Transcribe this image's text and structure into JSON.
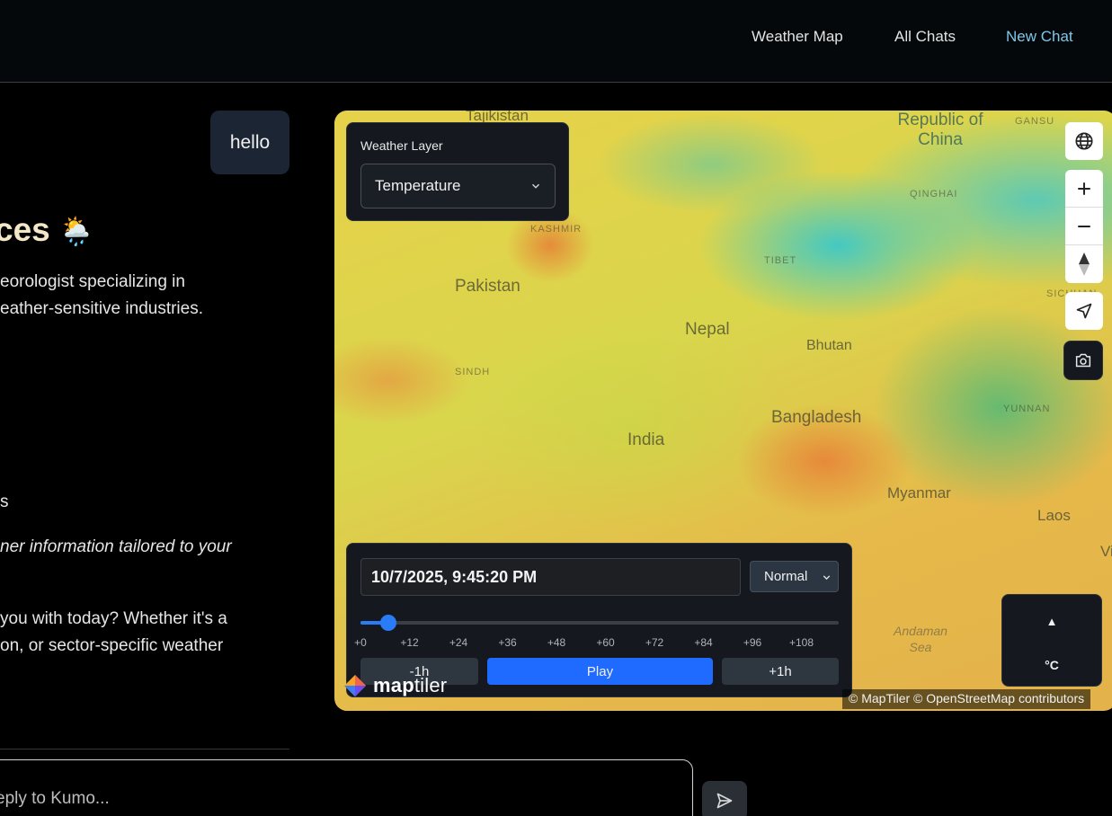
{
  "nav": {
    "items": [
      {
        "label": "Weather Map"
      },
      {
        "label": "All Chats"
      },
      {
        "label": "New Chat"
      }
    ]
  },
  "chat": {
    "user_message": "hello",
    "assistant": {
      "title": "ces",
      "title_emoji": "🌦️",
      "intro_line1": "eorologist specializing in",
      "intro_line2": "eather-sensitive industries.",
      "list_fragment": "s",
      "tagline": "ner information tailored to your",
      "question_line1": " you with today? Whether it's a",
      "question_line2": "on, or sector-specific weather"
    },
    "composer": {
      "placeholder": "eply to Kumo..."
    }
  },
  "map": {
    "weather_layer": {
      "title": "Weather Layer",
      "selected": "Temperature"
    },
    "labels": {
      "tajikistan": "Tajikistan",
      "china": "Republic of China",
      "pakistan": "Pakistan",
      "nepal": "Nepal",
      "bhutan": "Bhutan",
      "bangladesh": "Bangladesh",
      "india": "India",
      "myanmar": "Myanmar",
      "laos": "Laos",
      "vietnam": "Vi",
      "tibet": "TIBET",
      "qinghai": "QINGHAI",
      "sichuan": "SICHUAN",
      "yunnan": "YUNNAN",
      "sindh": "SINDH",
      "kashmir": "KASHMIR",
      "gansu": "GANSU",
      "andaman_sea": "Andaman Sea"
    },
    "timeline": {
      "datetime": "10/7/2025, 9:45:20 PM",
      "speed": "Normal",
      "position_hours": 7,
      "max_hours": 120,
      "ticks": [
        "+0",
        "+12",
        "+24",
        "+36",
        "+48",
        "+60",
        "+72",
        "+84",
        "+96",
        "+108"
      ],
      "back_label": "-1h",
      "play_label": "Play",
      "forward_label": "+1h"
    },
    "unit": {
      "arrow": "▲",
      "label": "°C"
    },
    "attribution": "© MapTiler © OpenStreetMap contributors",
    "logo": {
      "brand_bold": "map",
      "brand_light": "tiler"
    },
    "controls": [
      "globe-icon",
      "zoom-in-icon",
      "zoom-out-icon",
      "compass-icon",
      "geolocate-icon",
      "camera-icon"
    ]
  }
}
